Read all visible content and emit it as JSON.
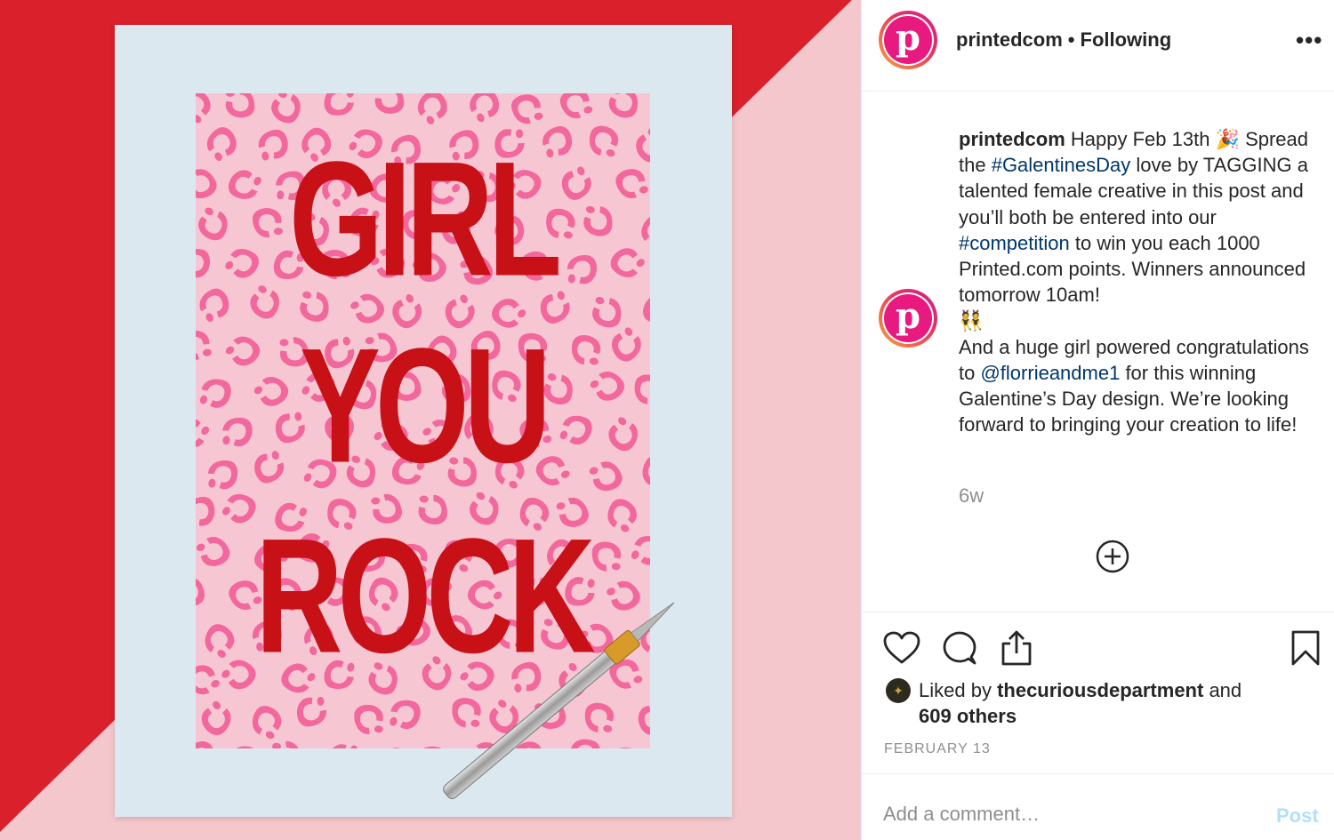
{
  "photo": {
    "poster_lines": [
      "GIRL",
      "YOU",
      "ROCK"
    ],
    "colors": {
      "background_red": "#d9202b",
      "background_pink": "#f4c7cc",
      "mat": "#dce8f0",
      "print_pink": "#f6c6d2",
      "leopard_spots": "#f2679c",
      "lettering": "#c81017"
    }
  },
  "header": {
    "avatar_letter": "p",
    "username": "printedcom",
    "separator": "•",
    "follow_status": "Following",
    "more_icon": "ellipsis-icon",
    "more_label": "•••"
  },
  "caption": {
    "avatar_letter": "p",
    "username": "printedcom",
    "seg1": " Happy Feb 13th 🎉 Spread the ",
    "hashtag1": "#GalentinesDay",
    "seg2": " love by TAGGING a talented female creative in this post and you’ll both be entered into our ",
    "hashtag2": "#competition",
    "seg3": " to win you each 1000 Printed.com points. Winners announced tomorrow 10am!",
    "emoji_line": "👯",
    "seg4": "And a huge girl powered congratulations to ",
    "mention": "@florrieandme1",
    "seg5": " for this winning Galentine’s Day design. We’re looking forward to bringing your creation to life!",
    "time": "6w"
  },
  "actions": {
    "icons": [
      "heart-icon",
      "comment-icon",
      "share-icon",
      "bookmark-icon",
      "add-circle-icon"
    ]
  },
  "likes": {
    "prefix": "Liked by ",
    "user": "thecuriousdepartment",
    "middle": " and ",
    "others": "609 others"
  },
  "date": "FEBRUARY 13",
  "comment": {
    "placeholder": "Add a comment…",
    "post_label": "Post",
    "post_color": "#b2dffc"
  }
}
